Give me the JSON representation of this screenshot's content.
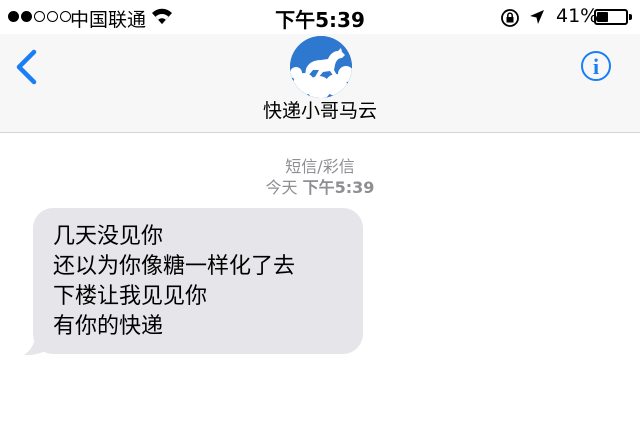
{
  "status_bar": {
    "signal_dots": [
      "filled",
      "filled",
      "empty",
      "empty",
      "empty"
    ],
    "carrier": "中国联通",
    "time": "下午5:39",
    "battery_percent": "41%",
    "battery_level": 0.41,
    "icons": [
      "wifi-icon",
      "rotation-lock-icon",
      "location-arrow-icon",
      "battery-icon"
    ]
  },
  "header": {
    "back_icon": "chevron-left-icon",
    "contact_name": "快递小哥马云",
    "avatar_icon": "horse-cloud-avatar",
    "info_icon_glyph": "i"
  },
  "conversation": {
    "message_type": "短信/彩信",
    "timestamp_day": "今天",
    "timestamp_time": "下午5:39",
    "messages": [
      {
        "direction": "incoming",
        "lines": [
          "几天没见你",
          "还以为你像糖一样化了去",
          "下楼让我见见你",
          "有你的快递"
        ]
      }
    ]
  },
  "colors": {
    "accent": "#1a7ef5",
    "bubble_incoming": "#e5e5ea",
    "header_bg": "#f7f7f7",
    "meta_text": "#8e8e93"
  }
}
